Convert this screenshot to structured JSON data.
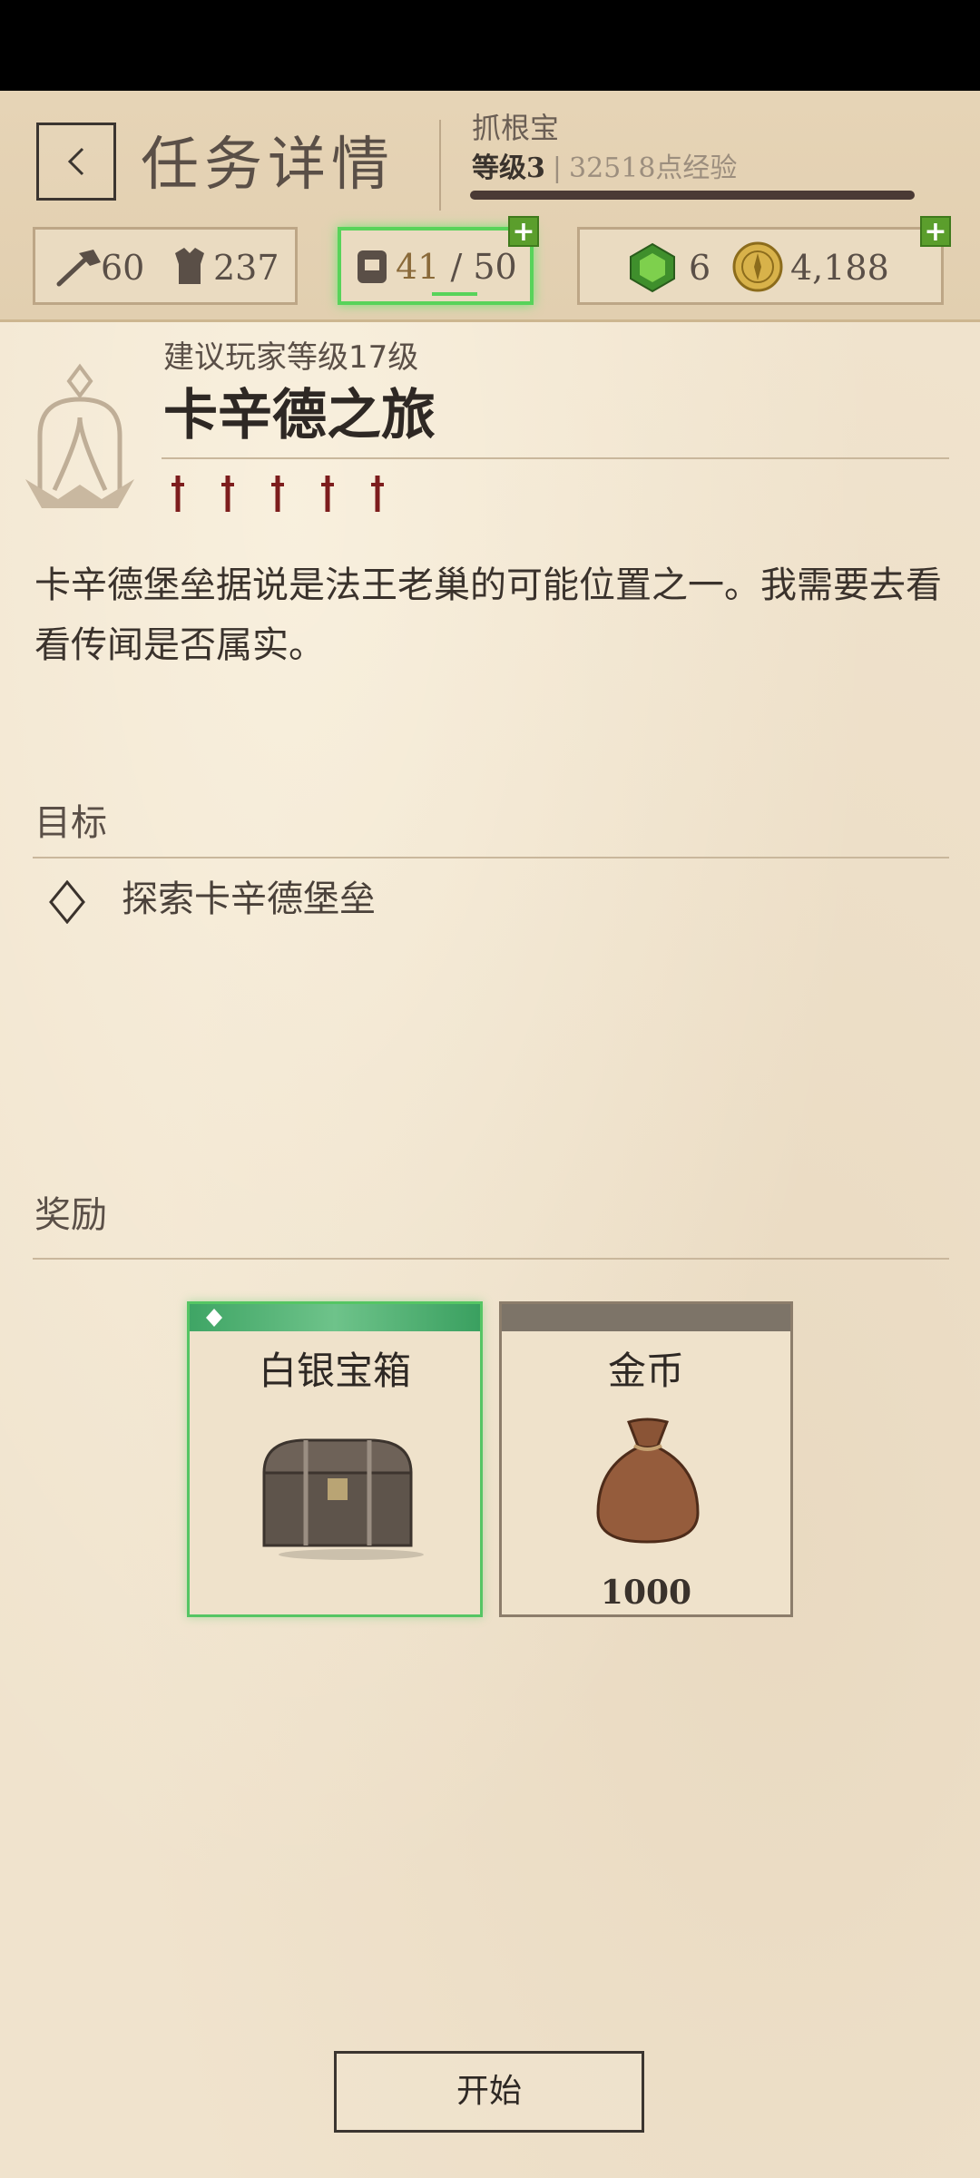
{
  "header": {
    "title": "任务详情",
    "player_name": "抓根宝",
    "level": "等级3",
    "separator": "|",
    "xp": "32518点经验",
    "xp_progress": 1.0
  },
  "resources": {
    "axe": {
      "icon": "axe-icon",
      "value": "60"
    },
    "armor": {
      "icon": "armor-icon",
      "value": "237"
    },
    "inventory": {
      "icon": "backpack-icon",
      "current": "41",
      "separator": " / ",
      "max": "50",
      "accent": "#58d35a"
    },
    "gems": {
      "icon": "green-gem-icon",
      "value": "6"
    },
    "gold": {
      "icon": "gold-coin-icon",
      "value": "4,188"
    },
    "plus_label": "+"
  },
  "quest": {
    "recommended_level": "建议玩家等级17级",
    "title": "卡辛德之旅",
    "difficulty": 5,
    "description": "卡辛德堡垒据说是法王老巢的可能位置之一。我需要去看看传闻是否属实。"
  },
  "objectives": {
    "label": "目标",
    "items": [
      {
        "text": "探索卡辛德堡垒",
        "icon": "diamond-outline-icon"
      }
    ]
  },
  "rewards": {
    "label": "奖励",
    "items": [
      {
        "name": "白银宝箱",
        "amount": "",
        "icon": "silver-chest-icon",
        "rarity_color": "#3fa565"
      },
      {
        "name": "金币",
        "amount": "1000",
        "icon": "coin-bag-icon",
        "rarity_color": "#7d7468"
      }
    ]
  },
  "start_button": "开始"
}
